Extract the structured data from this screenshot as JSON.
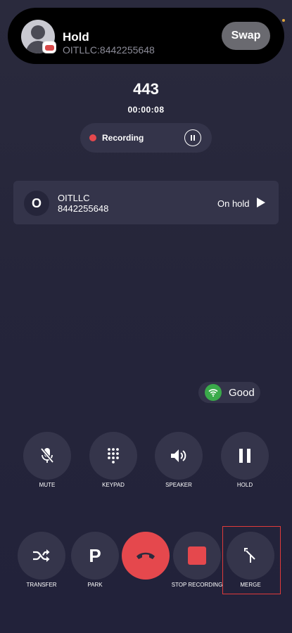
{
  "hold_banner": {
    "title": "Hold",
    "subtitle": "OITLLC:8442255648",
    "swap_label": "Swap"
  },
  "active_call": {
    "number": "443",
    "timer": "00:00:08",
    "recording_label": "Recording"
  },
  "held_call": {
    "avatar_initial": "O",
    "name": "OITLLC",
    "number": "8442255648",
    "status": "On hold"
  },
  "network": {
    "quality": "Good",
    "quality_color": "#3aaa4a"
  },
  "controls_row1": [
    {
      "label": "MUTE",
      "icon": "mic-off-icon"
    },
    {
      "label": "KEYPAD",
      "icon": "keypad-icon"
    },
    {
      "label": "SPEAKER",
      "icon": "speaker-icon"
    },
    {
      "label": "HOLD",
      "icon": "pause-icon"
    }
  ],
  "controls_row2": [
    {
      "label": "TRANSFER",
      "icon": "shuffle-icon"
    },
    {
      "label": "PARK",
      "icon": "park-icon",
      "glyph": "P"
    },
    {
      "label": "",
      "icon": "end-call-icon"
    },
    {
      "label": "STOP RECORDING",
      "icon": "stop-icon"
    },
    {
      "label": "MERGE",
      "icon": "merge-icon"
    }
  ],
  "colors": {
    "end_call": "#e5484d",
    "recording_dot": "#e5484d",
    "highlight": "#e03a3a"
  }
}
